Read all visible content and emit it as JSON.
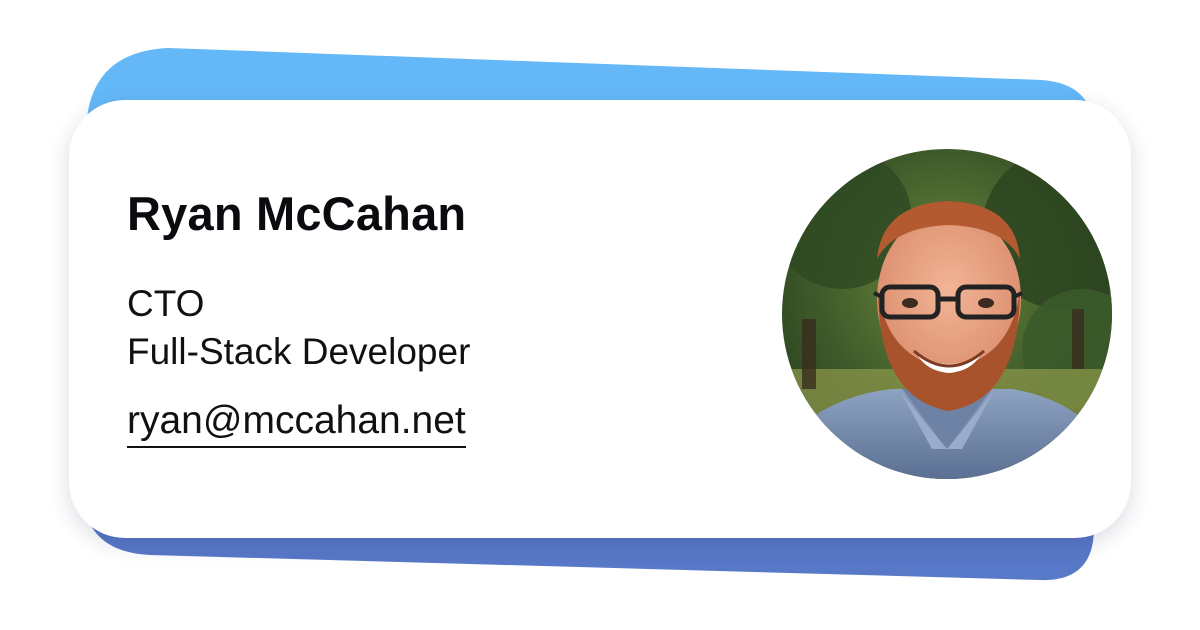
{
  "profile": {
    "name": "Ryan McCahan",
    "roles": [
      "CTO",
      "Full-Stack Developer"
    ],
    "email": "ryan@mccahan.net"
  },
  "colors": {
    "top_band": "#64b8f8",
    "bottom_band": "#5878c8",
    "card": "#ffffff",
    "text": "#111114"
  },
  "avatar": {
    "icon": "profile-photo"
  }
}
